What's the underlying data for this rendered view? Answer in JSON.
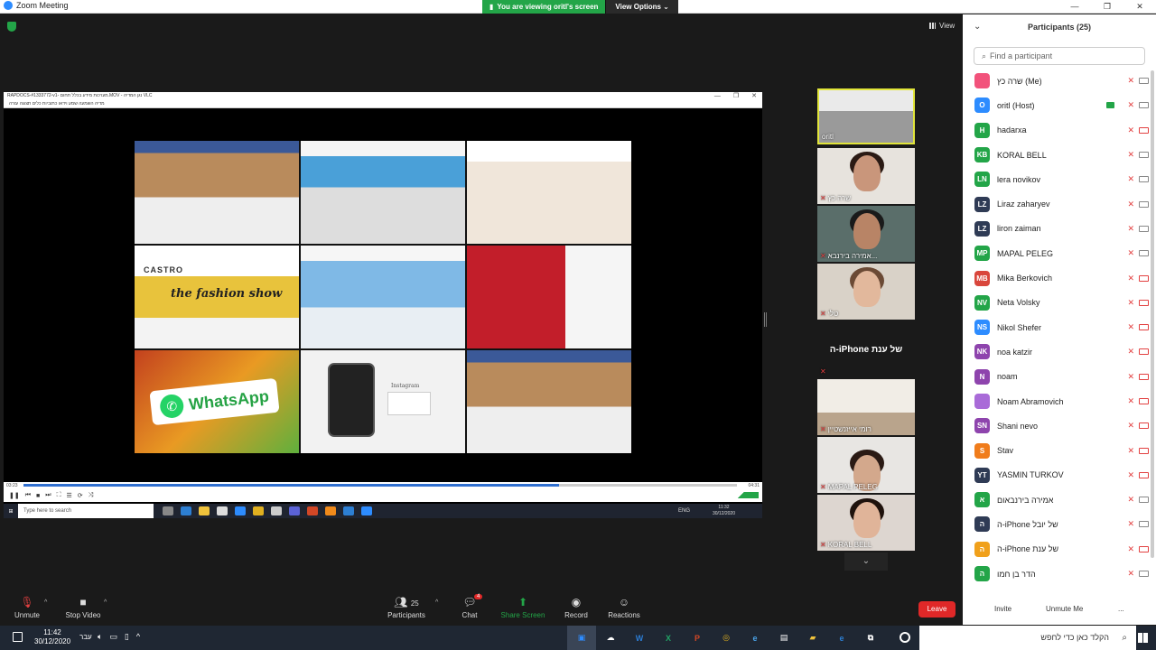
{
  "window": {
    "title": "Zoom Meeting",
    "controls": [
      "—",
      "❐",
      "✕"
    ]
  },
  "share_bar": {
    "viewing": "You are viewing oritl's screen",
    "view_options": "View Options ⌄"
  },
  "stage": {
    "view_label": "View"
  },
  "vlc": {
    "title": "RAPDOCS-#1333772-v1- מערכות מידע בכלל תחום.MOV - נגן המדיה VLC",
    "menu": "מדיה  השמעה  שמע  וידאו  כתוביות  כלים  תצוגה  עזרה",
    "time_elapsed": "03:23",
    "time_total": "04:31",
    "progress": 0.75,
    "volume": "91%"
  },
  "tiles": {
    "castro": "CASTRO",
    "fashion": "the fashion show",
    "whatsapp": "WhatsApp",
    "instagram": "Instagram"
  },
  "inner_taskbar": {
    "search": "Type here to search",
    "lang": "ENG",
    "time": "11:32",
    "date": "30/12/2020"
  },
  "thumbnails": [
    {
      "name": "oritl",
      "muted": false,
      "active": true
    },
    {
      "name": "שרה כץ",
      "muted": true
    },
    {
      "name": "אמירה בירנבא...",
      "muted": true
    },
    {
      "name": "טלי",
      "muted": true
    },
    {
      "name": "",
      "big_label": "ה-iPhone של ענת",
      "muted": true
    },
    {
      "name": "רומי אייזנשטיין",
      "muted": true
    },
    {
      "name": "MAPAL PELEG",
      "muted": true
    },
    {
      "name": "KORAL BELL",
      "muted": true
    }
  ],
  "participants": {
    "title": "Participants (25)",
    "search_placeholder": "Find a participant",
    "list": [
      {
        "initials": "",
        "name": "שרה כץ (Me)",
        "color": "#f2527b",
        "sharing": false,
        "video": true
      },
      {
        "initials": "O",
        "name": "oritl (Host)",
        "color": "#2d8cff",
        "sharing": true,
        "video": true
      },
      {
        "initials": "H",
        "name": "hadarxa",
        "color": "#23a548",
        "sharing": false,
        "video": false
      },
      {
        "initials": "KB",
        "name": "KORAL BELL",
        "color": "#23a548",
        "sharing": false,
        "video": true
      },
      {
        "initials": "LN",
        "name": "lera novikov",
        "color": "#23a548",
        "sharing": false,
        "video": true
      },
      {
        "initials": "LZ",
        "name": "Liraz zaharyev",
        "color": "#2f3b55",
        "sharing": false,
        "video": true
      },
      {
        "initials": "LZ",
        "name": "liron zaiman",
        "color": "#2f3b55",
        "sharing": false,
        "video": true
      },
      {
        "initials": "MP",
        "name": "MAPAL PELEG",
        "color": "#23a548",
        "sharing": false,
        "video": true
      },
      {
        "initials": "MB",
        "name": "Mika Berkovich",
        "color": "#d9463c",
        "sharing": false,
        "video": false
      },
      {
        "initials": "NV",
        "name": "Neta Volsky",
        "color": "#23a548",
        "sharing": false,
        "video": false
      },
      {
        "initials": "NS",
        "name": "Nikol Shefer",
        "color": "#2d8cff",
        "sharing": false,
        "video": false
      },
      {
        "initials": "NK",
        "name": "noa katzir",
        "color": "#8e44ad",
        "sharing": false,
        "video": false
      },
      {
        "initials": "N",
        "name": "noam",
        "color": "#8e44ad",
        "sharing": false,
        "video": false
      },
      {
        "initials": "",
        "name": "Noam Abramovich",
        "color": "#a96bd8",
        "sharing": false,
        "video": false
      },
      {
        "initials": "SN",
        "name": "Shani nevo",
        "color": "#8e44ad",
        "sharing": false,
        "video": false
      },
      {
        "initials": "S",
        "name": "Stav",
        "color": "#f07c1b",
        "sharing": false,
        "video": false
      },
      {
        "initials": "YT",
        "name": "YASMIN TURKOV",
        "color": "#2f3b55",
        "sharing": false,
        "video": false
      },
      {
        "initials": "א",
        "name": "אמירה בירנבאום",
        "color": "#23a548",
        "sharing": false,
        "video": true
      },
      {
        "initials": "ה",
        "name": "ה-iPhone של יובל",
        "color": "#2f3b55",
        "sharing": false,
        "video": true
      },
      {
        "initials": "ה",
        "name": "ה-iPhone של ענת",
        "color": "#f0a01b",
        "sharing": false,
        "video": false
      },
      {
        "initials": "ה",
        "name": "הדר בן חמו",
        "color": "#23a548",
        "sharing": false,
        "video": true
      }
    ],
    "invite": "Invite",
    "unmute_me": "Unmute Me",
    "more": "..."
  },
  "toolbar": {
    "unmute": "Unmute",
    "stop_video": "Stop Video",
    "participants": "Participants",
    "participants_count": "25",
    "chat": "Chat",
    "chat_badge": "4",
    "share_screen": "Share Screen",
    "record": "Record",
    "reactions": "Reactions",
    "leave": "Leave"
  },
  "taskbar": {
    "time": "11:42",
    "date": "30/12/2020",
    "lang": "עבר",
    "search": "הקלד כאן כדי לחפש"
  },
  "colors": {
    "accent_green": "#23a548",
    "zoom_blue": "#2d8cff",
    "leave_red": "#e02828"
  }
}
